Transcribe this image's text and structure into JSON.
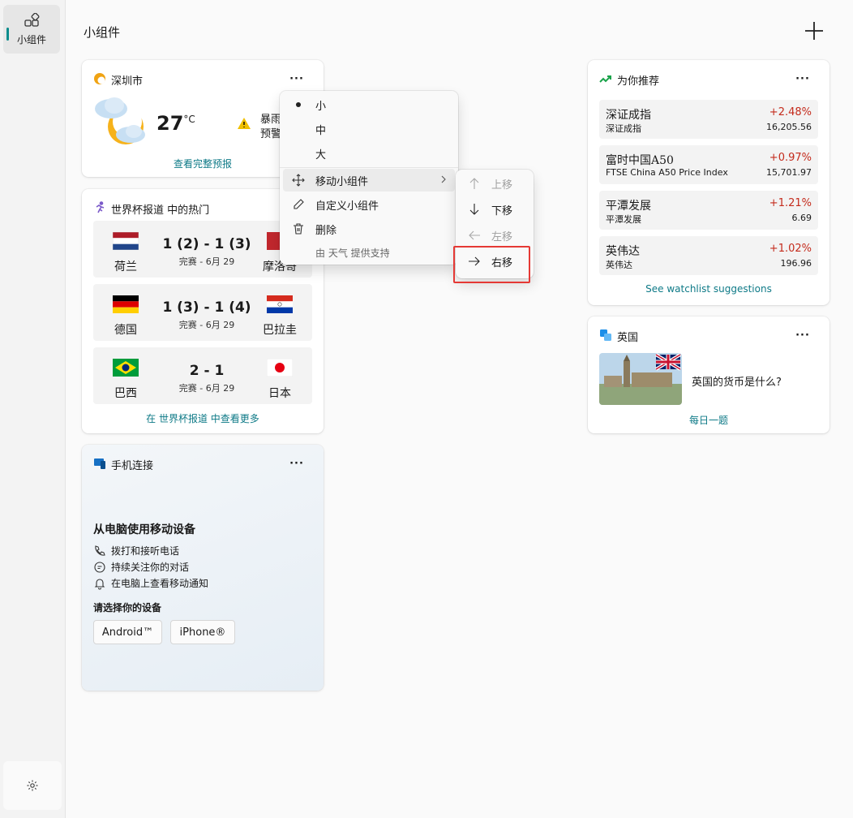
{
  "rail": {
    "label": "小组件"
  },
  "board": {
    "title": "小组件"
  },
  "weather": {
    "city": "深圳市",
    "temp": "27",
    "unit": "°C",
    "alert_line1": "暴雨",
    "alert_line2": "预警",
    "link": "查看完整预报"
  },
  "worldcup": {
    "title": "世界杯报道 中的热门",
    "matches": [
      {
        "home": "荷兰",
        "away": "摩洛哥",
        "score": "1 (2) - 1 (3)",
        "status": "完赛 - 6月 29"
      },
      {
        "home": "德国",
        "away": "巴拉圭",
        "score": "1 (3) - 1 (4)",
        "status": "完赛 - 6月 29"
      },
      {
        "home": "巴西",
        "away": "日本",
        "score": "2 - 1",
        "status": "完赛 - 6月 29"
      }
    ],
    "link": "在 世界杯报道 中查看更多"
  },
  "phone": {
    "title": "手机连接",
    "heading": "从电脑使用移动设备",
    "features": [
      "拨打和接听电话",
      "持续关注你的对话",
      "在电脑上查看移动通知"
    ],
    "choose": "请选择你的设备",
    "android": "Android™",
    "iphone": "iPhone®"
  },
  "stocks": {
    "title": "为你推荐",
    "items": [
      {
        "name": "深证成指",
        "sub": "深证成指",
        "change": "+2.48%",
        "price": "16,205.56"
      },
      {
        "name": "富时中国A50",
        "sub": "FTSE China A50 Price Index",
        "change": "+0.97%",
        "price": "15,701.97"
      },
      {
        "name": "平潭发展",
        "sub": "平潭发展",
        "change": "+1.21%",
        "price": "6.69"
      },
      {
        "name": "英伟达",
        "sub": "英伟达",
        "change": "+1.02%",
        "price": "196.96"
      }
    ],
    "link": "See watchlist suggestions"
  },
  "uk": {
    "title": "英国",
    "question": "英国的货币是什么?",
    "link": "每日一题"
  },
  "context_menu": {
    "small": "小",
    "medium": "中",
    "large": "大",
    "move": "移动小组件",
    "customize": "自定义小组件",
    "delete": "删除",
    "footer": "由 天气 提供支持"
  },
  "submenu": {
    "up": "上移",
    "down": "下移",
    "left": "左移",
    "right": "右移"
  },
  "colors": {
    "accent": "#0e7a87",
    "positive": "#c42b1c",
    "highlight": "#e53935"
  }
}
